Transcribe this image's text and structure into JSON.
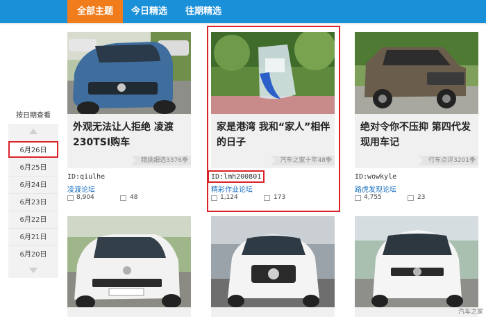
{
  "nav": {
    "tabs": [
      {
        "label": "全部主题",
        "active": true
      },
      {
        "label": "今日精选",
        "active": false
      },
      {
        "label": "往期精选",
        "active": false
      }
    ]
  },
  "sidebar": {
    "title": "按日期查看",
    "dates": [
      "6月26日",
      "6月25日",
      "6月24日",
      "6月23日",
      "6月22日",
      "6月21日",
      "6月20日"
    ],
    "selected_date": "6月26日"
  },
  "cards": [
    {
      "title": "外观无法让人拒绝 凌渡230TSI购车",
      "tag": "精挑细选3376季",
      "user": "ID:qiulhe",
      "forum": "凌渡论坛",
      "views": "8,904",
      "replies": "48"
    },
    {
      "title": "家是港湾 我和“家人”相伴的日子",
      "tag": "汽车之家十年48季",
      "user": "ID:lmh200801",
      "forum": "精彩作业论坛",
      "views": "1,124",
      "replies": "173"
    },
    {
      "title": "绝对令你不压抑 第四代发现用车记",
      "tag": "行车点评3201季",
      "user": "ID:wowkyle",
      "forum": "路虎发现论坛",
      "views": "4,755",
      "replies": "23"
    }
  ],
  "watermark": "汽车之家",
  "colors": {
    "nav_blue": "#1a90d9",
    "nav_active": "#f07c1b",
    "highlight_red": "#d9232a",
    "link_blue": "#1a6fc0"
  }
}
